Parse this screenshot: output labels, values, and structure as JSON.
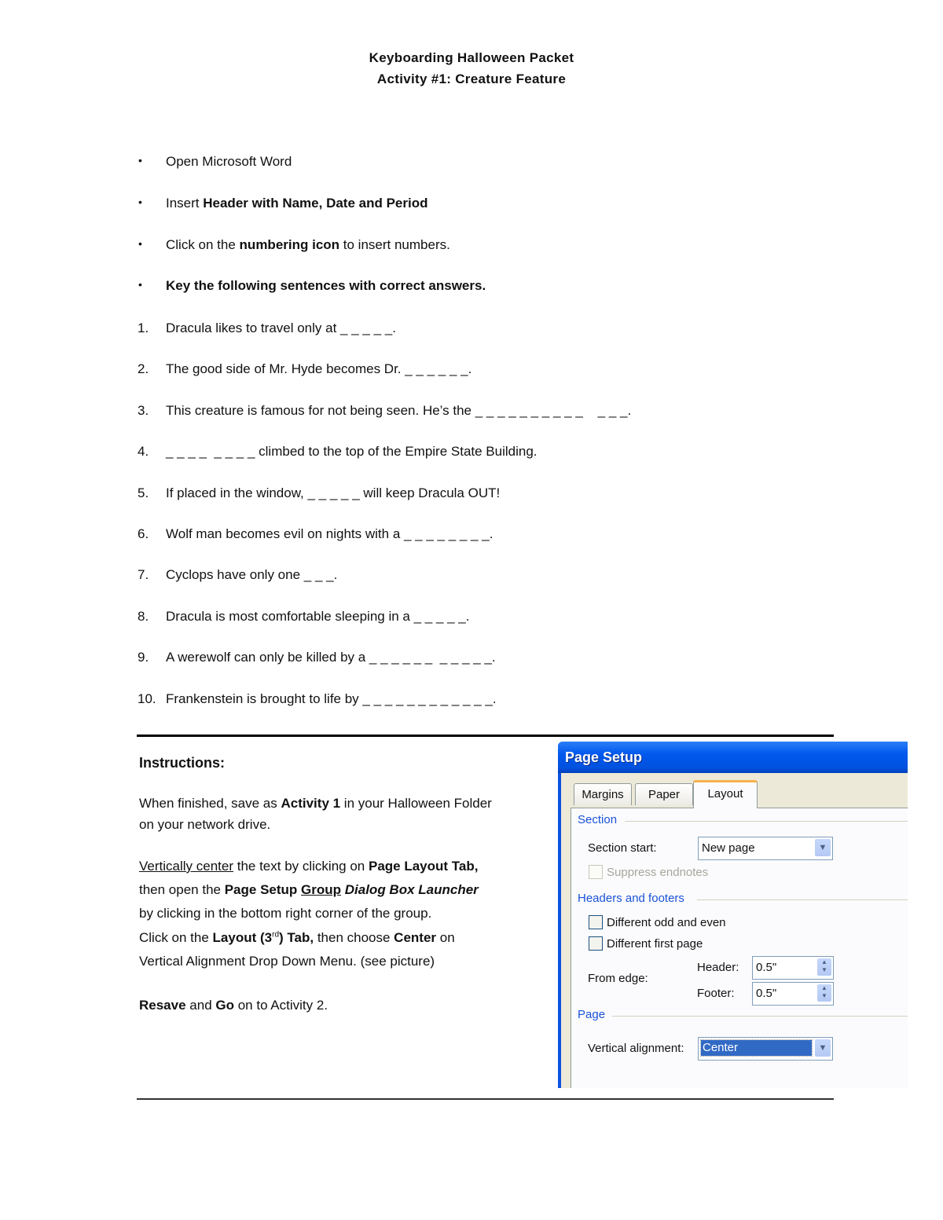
{
  "document": {
    "title": "Keyboarding Halloween Packet",
    "subtitle": "Activity #1: Creature Feature"
  },
  "bullets": [
    {
      "marker": "•",
      "parts": [
        {
          "t": "Open Microsoft Word",
          "b": false
        }
      ]
    },
    {
      "marker": "•",
      "parts": [
        {
          "t": "Insert ",
          "b": false
        },
        {
          "t": "Header with Name, Date and Period",
          "b": true
        }
      ]
    },
    {
      "marker": "•",
      "parts": [
        {
          "t": "Click on the ",
          "b": false
        },
        {
          "t": "numbering icon",
          "b": true
        },
        {
          "t": " to insert numbers.",
          "b": false
        }
      ]
    },
    {
      "marker": "•",
      "parts": [
        {
          "t": "Key the following sentences with correct answers.",
          "b": true
        }
      ]
    }
  ],
  "questions": [
    {
      "number": "1.",
      "text": "Dracula likes to travel only at _ _ _ _ _."
    },
    {
      "number": "2.",
      "text": "The good side of Mr. Hyde becomes Dr. _ _ _ _ _ _."
    },
    {
      "number": "3.",
      "text": "This creature is famous for not being seen. He’s the _ _ _ _ _ _ _ _ _ _    _ _ _."
    },
    {
      "number": "4.",
      "text": "_ _ _ _  _ _ _ _ climbed to the top of the Empire State Building."
    },
    {
      "number": "5.",
      "text": "If placed in the window, _ _ _ _ _ will keep Dracula OUT!"
    },
    {
      "number": "6.",
      "text": "Wolf man becomes evil on nights with a _ _ _ _ _ _ _ _."
    },
    {
      "number": "7.",
      "text": "Cyclops have only one _ _ _."
    },
    {
      "number": "8.",
      "text": "Dracula is most comfortable sleeping in a _ _ _ _ _."
    },
    {
      "number": "9.",
      "text": "A werewolf can only be killed by a _ _ _ _ _ _  _ _ _ _ _."
    },
    {
      "number": "10.",
      "text": "Frankenstein is brought to life by _ _ _ _ _ _ _ _ _ _ _ _."
    }
  ],
  "instructions": {
    "heading": "Instructions:",
    "save_1": "When finished,  save as ",
    "save_bold": "Activity 1",
    "save_2": " in your Halloween Folder",
    "save_line2": "on your network drive.",
    "vc_underline": "Vertically center",
    "vc_1": " the text by clicking on ",
    "vc_bold": "Page Layout Tab,",
    "open_1": "then open the ",
    "open_bold": "Page Setup ",
    "open_group": "Group",
    "open_italic": " Dialog Box Launcher",
    "corner": "by clicking in the bottom right corner of the group.",
    "click_1": "Click on the ",
    "click_bold": "Layout (3",
    "click_sup": "rd",
    "click_bold2": ") Tab,",
    "click_2": " then choose ",
    "click_center": "Center",
    "click_3": " on",
    "vertical_menu": "Vertical Alignment Drop Down Menu.   (see picture)",
    "resave_bold": "Resave",
    "resave_1": " and ",
    "resave_go": "Go",
    "resave_2": " on to Activity 2."
  },
  "dialog": {
    "title": "Page Setup",
    "tabs": [
      "Margins",
      "Paper",
      "Layout"
    ],
    "active_tab": "Layout",
    "section_group": "Section",
    "section_start_label": "Section start:",
    "section_start_value": "New page",
    "suppress_endnotes_label": "Suppress endnotes",
    "suppress_endnotes_checked": false,
    "headers_group": "Headers and footers",
    "odd_even_label": "Different odd and even",
    "odd_even_checked": false,
    "first_page_label": "Different first page",
    "first_page_checked": false,
    "from_edge_label": "From edge:",
    "header_label": "Header:",
    "header_value": "0.5\"",
    "footer_label": "Footer:",
    "footer_value": "0.5\"",
    "page_group": "Page",
    "vertical_alignment_label": "Vertical alignment:",
    "vertical_alignment_value": "Center"
  }
}
